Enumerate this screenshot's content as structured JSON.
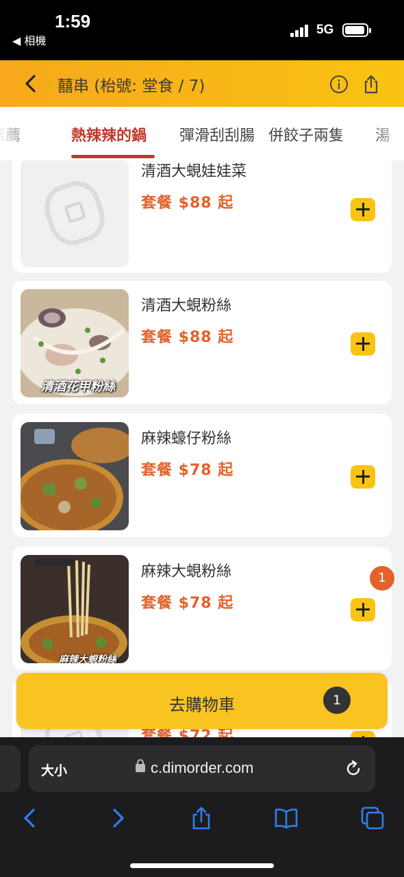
{
  "status_bar": {
    "time": "1:59",
    "back_app": "◀ 相機",
    "network": "5G"
  },
  "header": {
    "title": "囍串 (枱號: 堂食 / 7)"
  },
  "tabs": [
    "推薦",
    "熱辣辣的鍋",
    "彈滑刮刮腸",
    "併餃子兩隻",
    "湯"
  ],
  "active_tab": "熱辣辣的鍋",
  "menu": {
    "items": [
      {
        "name": "清酒大蜆娃娃菜",
        "price": "套餐 $88 起",
        "image": "placeholder"
      },
      {
        "name": "清酒大蜆粉絲",
        "price": "套餐 $88 起",
        "image": "photo",
        "caption": "清酒花甲粉絲"
      },
      {
        "name": "麻辣蠔仔粉絲",
        "price": "套餐 $78 起",
        "image": "photo"
      },
      {
        "name": "麻辣大蜆粉絲",
        "price": "套餐 $78 起",
        "image": "photo",
        "caption": "麻辣大蜆粉絲",
        "quantity_in_cart": "1"
      },
      {
        "name": "",
        "price": "套餐 $72 起",
        "image": "placeholder"
      }
    ]
  },
  "checkout": {
    "label": "去購物車",
    "count": "1"
  },
  "browser": {
    "text_size_label": "大小",
    "url": "c.dimorder.com"
  },
  "colors": {
    "accent": "#f9c313",
    "price": "#e4622a",
    "active_tab": "#c0382b"
  },
  "icons": [
    "back-chevron-icon",
    "info-icon",
    "share-icon",
    "plus-icon",
    "lock-icon",
    "reload-icon",
    "nav-back-icon",
    "nav-forward-icon",
    "share-sheet-icon",
    "bookmarks-icon",
    "tabs-icon"
  ]
}
